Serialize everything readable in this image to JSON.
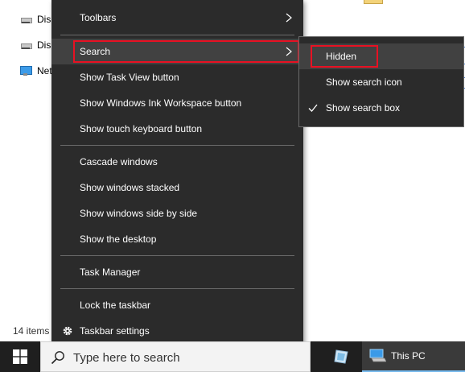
{
  "explorer": {
    "nav_items": [
      {
        "label": "Dis",
        "icon": "drive-icon"
      },
      {
        "label": "Dis",
        "icon": "drive-icon"
      },
      {
        "label": "Net",
        "icon": "network-icon"
      }
    ],
    "status": "14 items"
  },
  "context_menu": {
    "items": [
      {
        "label": "Toolbars",
        "has_submenu": true
      },
      {
        "label": "Search",
        "has_submenu": true,
        "highlighted": true
      },
      {
        "label": "Show Task View button"
      },
      {
        "label": "Show Windows Ink Workspace button"
      },
      {
        "label": "Show touch keyboard button"
      },
      {
        "label": "Cascade windows"
      },
      {
        "label": "Show windows stacked"
      },
      {
        "label": "Show windows side by side"
      },
      {
        "label": "Show the desktop"
      },
      {
        "label": "Task Manager"
      },
      {
        "label": "Lock the taskbar"
      },
      {
        "label": "Taskbar settings",
        "icon": "gear-icon"
      }
    ]
  },
  "search_submenu": {
    "items": [
      {
        "label": "Hidden",
        "highlighted": true
      },
      {
        "label": "Show search icon"
      },
      {
        "label": "Show search box",
        "checked": true
      }
    ]
  },
  "taskbar": {
    "search_placeholder": "Type here to search",
    "apps": [
      {
        "label": "",
        "icon": "app-icon"
      },
      {
        "label": "This PC",
        "icon": "this-pc-icon",
        "active": true
      }
    ]
  },
  "colors": {
    "menu_bg": "#2b2b2b",
    "menu_highlight": "#414141",
    "annotation_red": "#e81123",
    "taskbar_bg": "#1f1f1f",
    "active_app_underline": "#76b9ed"
  }
}
